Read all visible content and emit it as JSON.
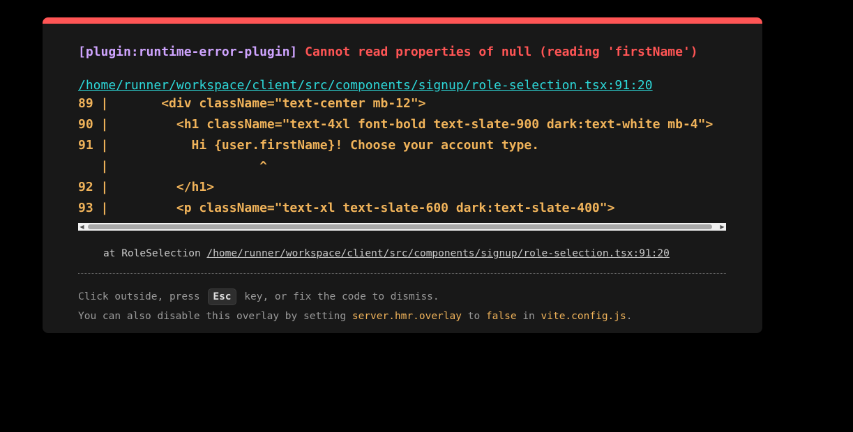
{
  "overlay": {
    "plugin": "[plugin:runtime-error-plugin]",
    "message": "Cannot read properties of null (reading 'firstName')",
    "file": "/home/runner/workspace/client/src/components/signup/role-selection.tsx:91:20",
    "frame_lines": [
      "89 |       <div className=\"text-center mb-12\">",
      "90 |         <h1 className=\"text-4xl font-bold text-slate-900 dark:text-white mb-4\">",
      "91 |           Hi {user.firstName}! Choose your account type.",
      "   |                    ^",
      "92 |         </h1>",
      "93 |         <p className=\"text-xl text-slate-600 dark:text-slate-400\">"
    ],
    "stack_prefix": "at RoleSelection",
    "stack_file": "/home/runner/workspace/client/src/components/signup/role-selection.tsx:91:20",
    "tip_line1_before": "Click outside, press",
    "tip_key": "Esc",
    "tip_line1_after": "key, or fix the code to dismiss.",
    "tip_line2_before": "You can also disable this overlay by setting",
    "tip_code1": "server.hmr.overlay",
    "tip_line2_mid1": "to",
    "tip_code2": "false",
    "tip_line2_mid2": "in",
    "tip_code3": "vite.config.js",
    "tip_line2_end": ".",
    "colors": {
      "accent_top_border": "#ff5555",
      "plugin": "#cfa4ff",
      "error": "#ff5555",
      "link": "#2dd9da",
      "code": "#f0b35a"
    }
  },
  "scrollbar": {
    "left_arrow_icon": "triangle-left-icon",
    "right_arrow_icon": "triangle-right-icon"
  }
}
